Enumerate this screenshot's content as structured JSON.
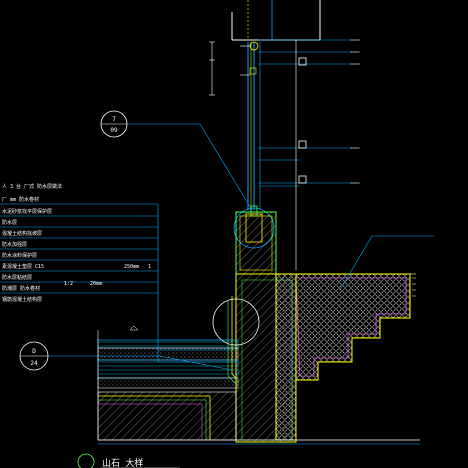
{
  "drawing": {
    "callout_upper": {
      "top": "7",
      "bottom": "09"
    },
    "callout_lower": {
      "top": "D",
      "bottom": "24"
    },
    "title": "山石 大样",
    "spec_notes": [
      "人 3 台 厂式 防水层做法",
      "厂 mm 防水卷材",
      "水泥砂浆找平层保护层",
      "防水层",
      "混凝土结构找坡层",
      "防水加强层",
      "防水涂料保护层",
      "素混凝土垫层 C15",
      "防水层粘结层",
      "防潮层 防水卷材",
      "钢筋混凝土结构层"
    ],
    "dim_values": [
      "250mm",
      "1",
      "1:2",
      "20mm"
    ],
    "colors": {
      "background": "#000000",
      "leader": "#00aaff",
      "outline_yellow": "#ffff00",
      "outline_green": "#55ff55",
      "outline_magenta": "#ff66ff",
      "text": "#ffffff"
    }
  }
}
